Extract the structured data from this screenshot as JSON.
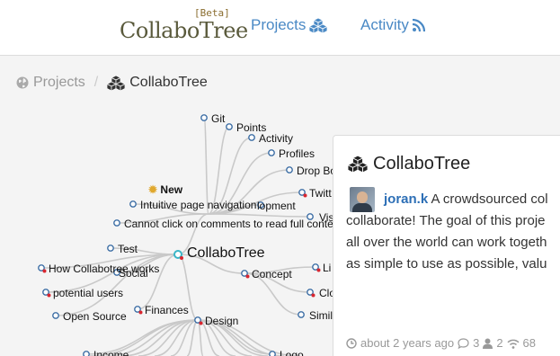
{
  "nav": {
    "logo_text": "CollaboTree",
    "beta_label": "[Beta]",
    "projects_label": "Projects",
    "activity_label": "Activity"
  },
  "breadcrumb": {
    "projects_label": "Projects",
    "separator": "/",
    "current_label": "CollaboTree"
  },
  "tree": {
    "root_label": "CollaboTree",
    "node_stroke_color": "#3d6ea5",
    "root_stroke_color": "#3ab5c7",
    "badge_color": "#d9262f",
    "new_label": "New",
    "nodes": [
      "Git",
      "Points",
      "Activity",
      "Profiles",
      "Drop Bo",
      "Twitt",
      "Vis",
      "Intuitive page navigation",
      "lopment",
      "Cannot click on comments to read full conte",
      "Test",
      "How Collabotree works",
      "Social",
      "potential users",
      "Open Source",
      "Finances",
      "Design",
      "Concept",
      "Li",
      "Clo",
      "Simil",
      "Income",
      "Logo"
    ]
  },
  "card": {
    "title": "CollaboTree",
    "author": "joran.k",
    "line1": "A crowdsourced col",
    "line2": "collaborate! The goal of this proje",
    "line3": "all over the world can work togeth",
    "line4": "as simple to use as possible, valu",
    "time": "about 2 years ago",
    "comments": "3",
    "users": "2",
    "views": "68"
  }
}
